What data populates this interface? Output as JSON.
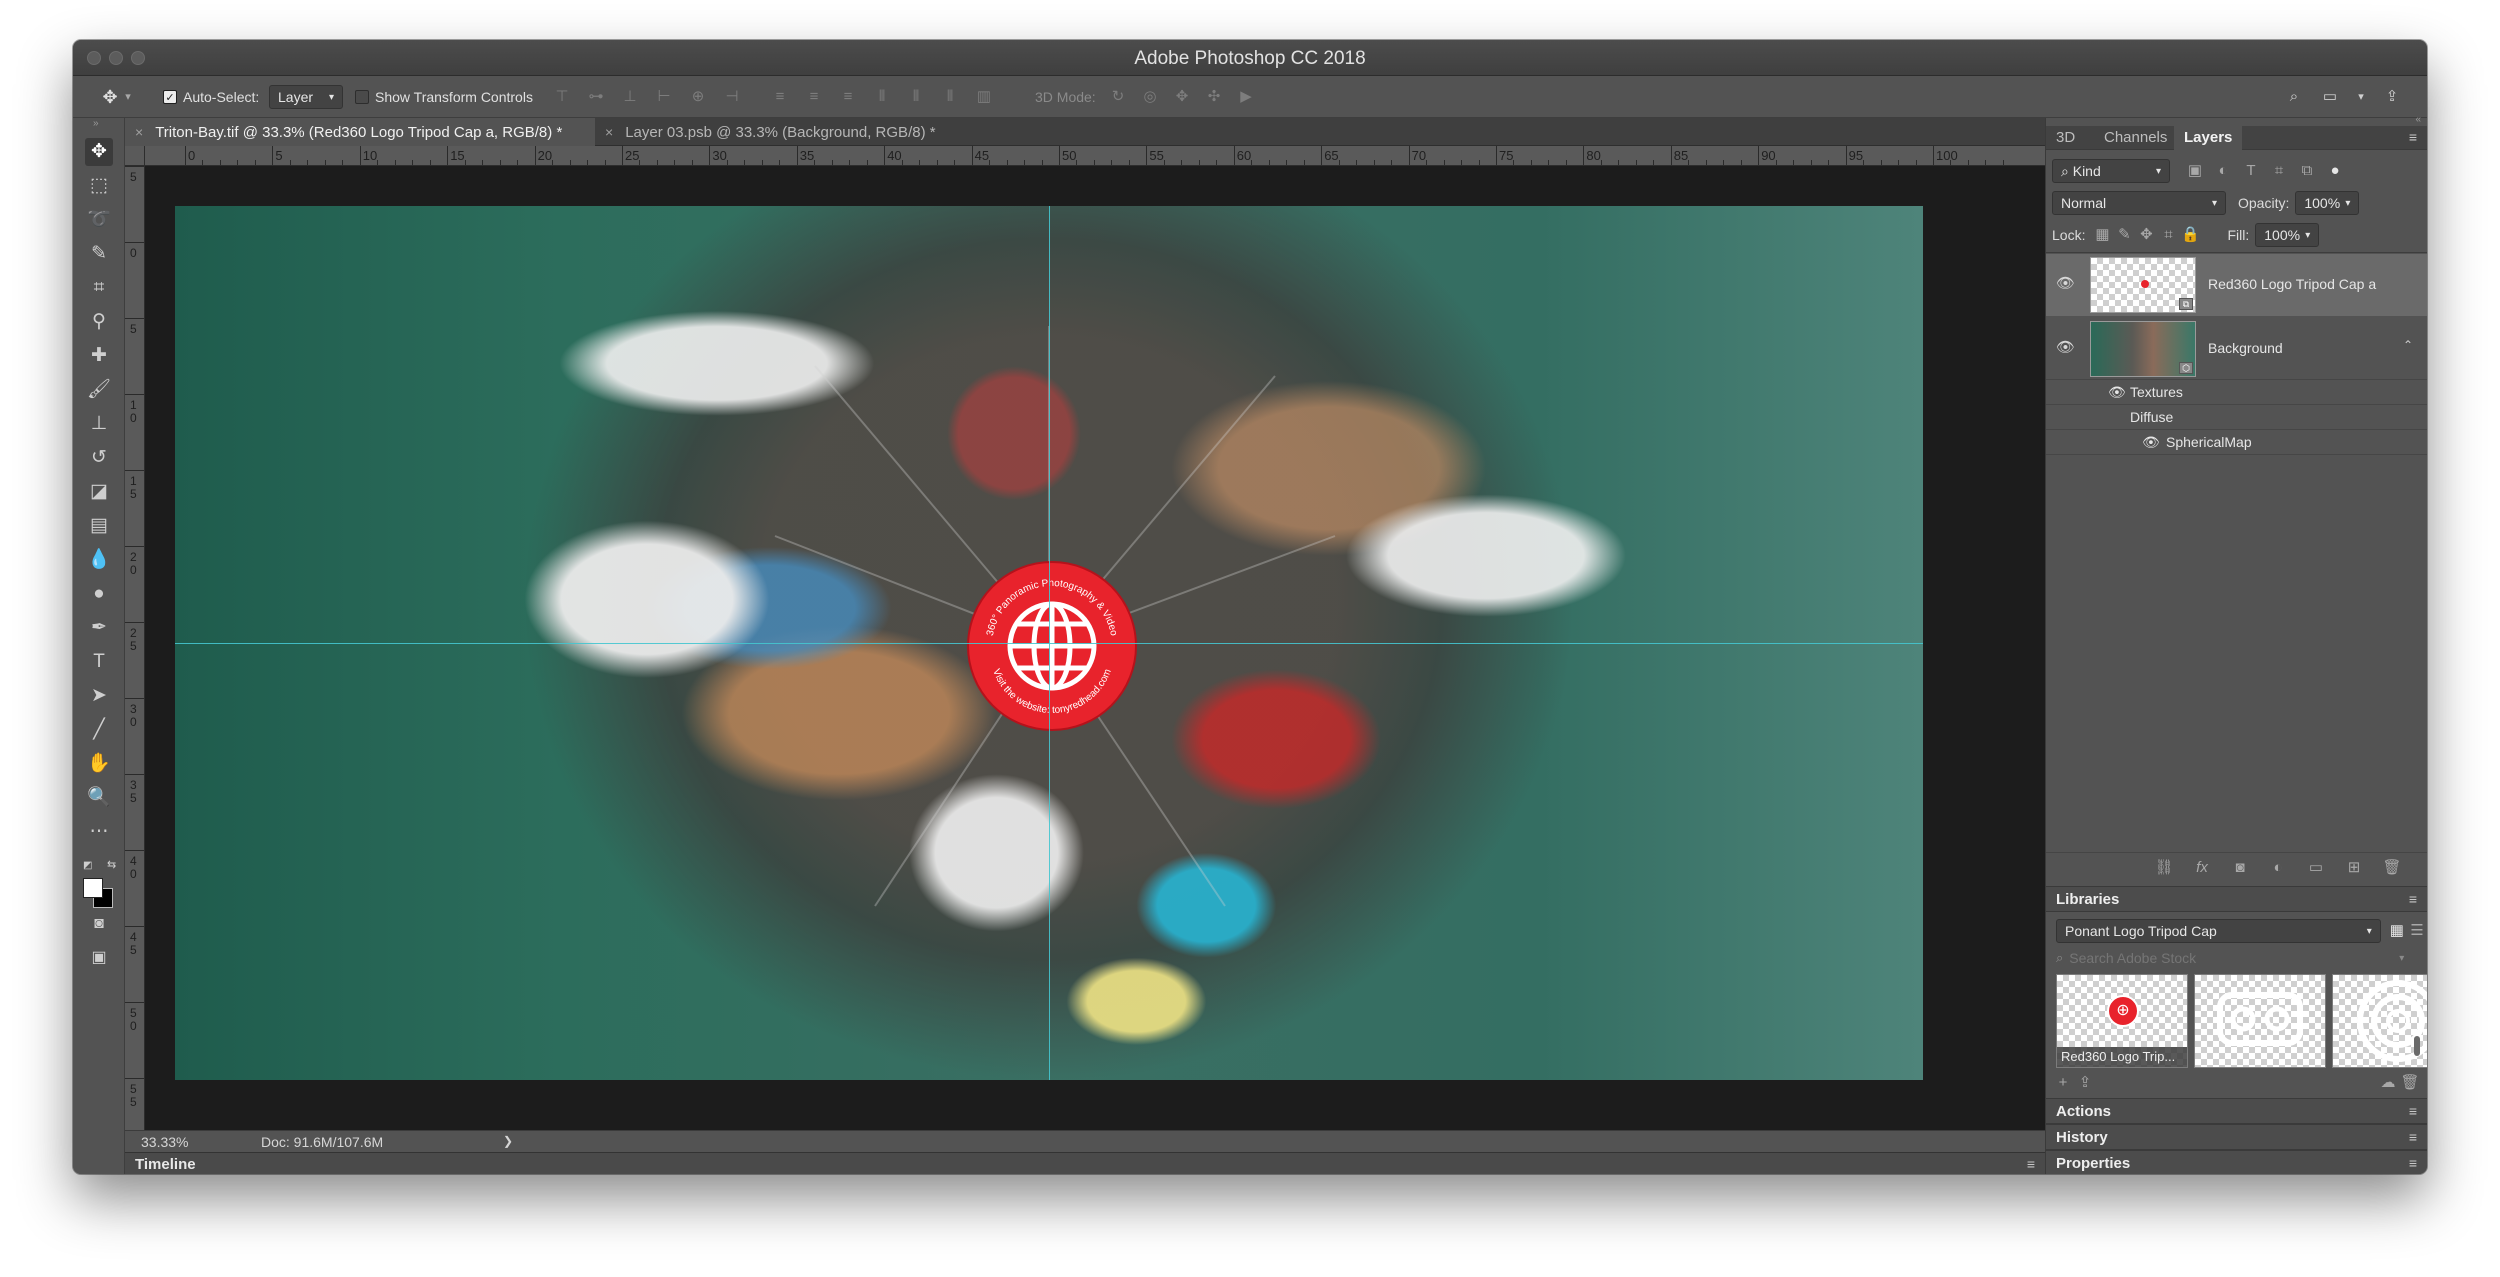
{
  "window": {
    "title": "Adobe Photoshop CC 2018"
  },
  "options_bar": {
    "auto_select_label": "Auto-Select:",
    "auto_select_checked": true,
    "auto_select_target": "Layer",
    "show_transform_label": "Show Transform Controls",
    "show_transform_checked": false,
    "mode_3d_label": "3D Mode:"
  },
  "doc_tabs": [
    {
      "label": "Triton-Bay.tif @ 33.3% (Red360 Logo Tripod Cap a, RGB/8) *",
      "active": true
    },
    {
      "label": "Layer 03.psb @ 33.3% (Background, RGB/8) *",
      "active": false
    }
  ],
  "ruler": {
    "top_ticks": [
      "0",
      "5",
      "10",
      "15",
      "20",
      "25",
      "30",
      "35",
      "40",
      "45",
      "50",
      "55",
      "60",
      "65",
      "70",
      "75",
      "80",
      "85",
      "90",
      "95",
      "100"
    ],
    "left_ticks": [
      "5",
      "0",
      "5",
      "1 0",
      "1 5",
      "2 0",
      "2 5",
      "3 0",
      "3 5",
      "4 0",
      "4 5",
      "5 0",
      "5 5"
    ]
  },
  "logo": {
    "top_text": "360° Panoramic Photography & Video",
    "bottom_text": "Visit the website: tonyredhead.com",
    "accent": "#e8232c"
  },
  "status": {
    "zoom": "33.33%",
    "doc": "Doc: 91.6M/107.6M",
    "arrow": "❯"
  },
  "timeline": {
    "label": "Timeline"
  },
  "layers_panel": {
    "tabs": [
      "3D",
      "Channels",
      "Layers"
    ],
    "active_tab": "Layers",
    "filter_kind": "Kind",
    "blend_mode": "Normal",
    "opacity_label": "Opacity:",
    "opacity_value": "100%",
    "lock_label": "Lock:",
    "fill_label": "Fill:",
    "fill_value": "100%",
    "layers": [
      {
        "name": "Red360 Logo Tripod Cap a",
        "visible": true,
        "selected": true
      },
      {
        "name": "Background",
        "visible": true,
        "selected": false
      }
    ],
    "effects": [
      {
        "name": "Textures",
        "has_eye": true
      },
      {
        "name": "Diffuse",
        "has_eye": false
      },
      {
        "name": "SphericalMap",
        "has_eye": true
      }
    ]
  },
  "libraries": {
    "header": "Libraries",
    "selected_library": "Ponant Logo Tripod Cap",
    "search_placeholder": "Search Adobe Stock",
    "items": [
      {
        "label": "Red360 Logo Trip..."
      },
      {
        "label": ""
      },
      {
        "label": ""
      }
    ]
  },
  "collapsed_panels": [
    "Actions",
    "History",
    "Properties"
  ],
  "colors": {
    "ui_bg": "#535353",
    "panel_dark": "#434343",
    "selection": "#6a6a6a",
    "guide": "#45c5cf",
    "foreground_swatch": "#ffffff",
    "background_swatch": "#000000"
  }
}
